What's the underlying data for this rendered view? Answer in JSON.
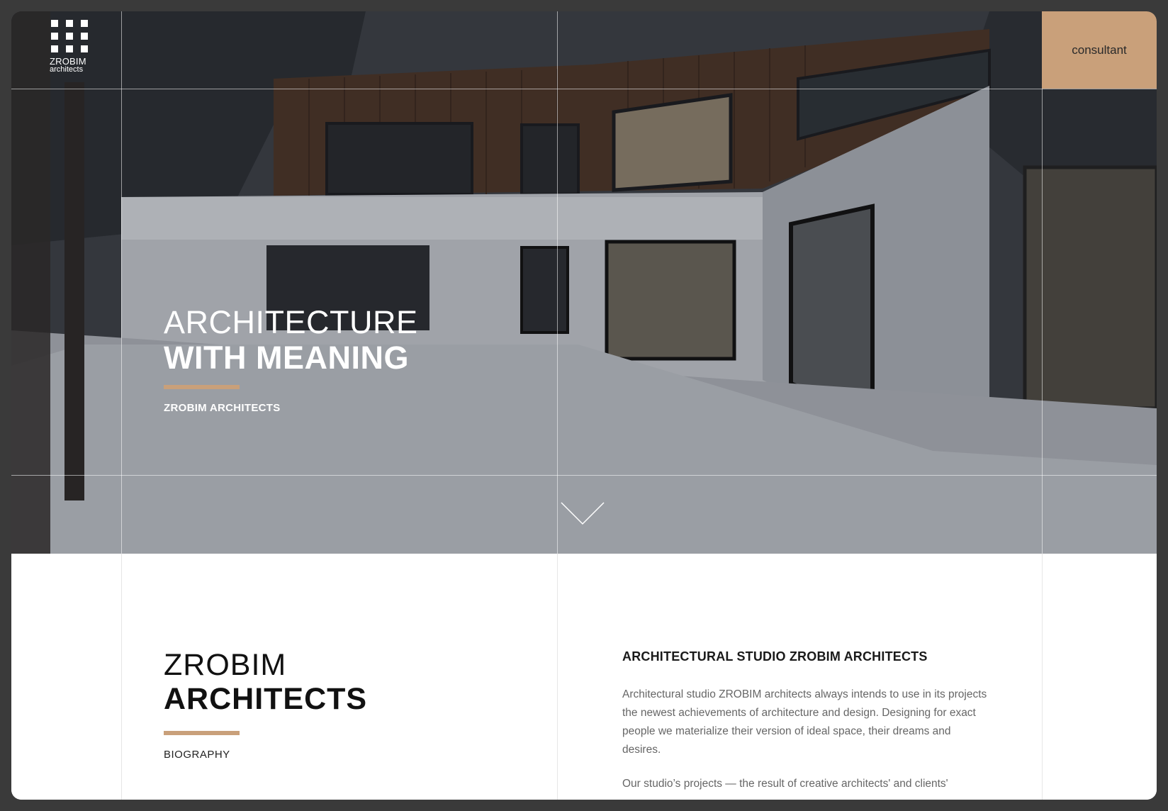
{
  "logo": {
    "brand": "ZROBIM",
    "sub": "architects"
  },
  "header": {
    "consultant_label": "consultant"
  },
  "hero": {
    "title_line1": "ARCHITECTURE",
    "title_line2": "WITH MEANING",
    "subtitle": "ZROBIM ARCHITECTS"
  },
  "about": {
    "title_line1": "ZROBIM",
    "title_line2": "ARCHITECTS",
    "subtitle": "BIOGRAPHY",
    "heading": "ARCHITECTURAL STUDIO ZROBIM ARCHITECTS",
    "paragraph1": "Architectural studio ZROBIM architects always intends to use in its projects the newest achievements of architecture and design. Designing for exact people we materialize their version of ideal space, their dreams and desires.",
    "paragraph2": "Our studio’s projects — the result of creative architects' and clients'"
  },
  "colors": {
    "accent": "#c9a07a",
    "backdrop": "#3a3a3a"
  },
  "icons": {
    "scroll": "chevron-down-icon"
  }
}
